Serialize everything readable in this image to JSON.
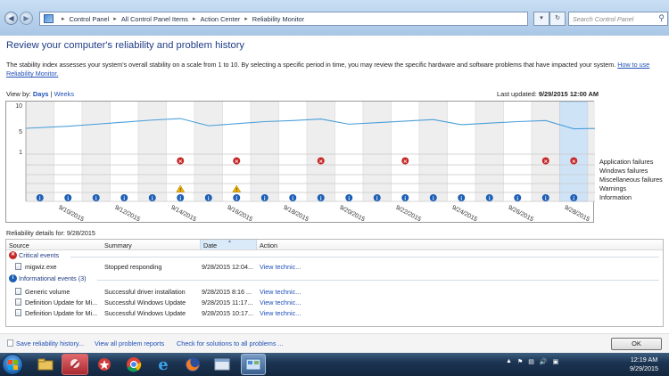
{
  "address_bar": {
    "crumbs": [
      "Control Panel",
      "All Control Panel Items",
      "Action Center",
      "Reliability Monitor"
    ],
    "search_placeholder": "Search Control Panel"
  },
  "page": {
    "title": "Review your computer's reliability and problem history",
    "description": "The stability index assesses your system's overall stability on a scale from 1 to 10. By selecting a specific period in time, you may review the specific hardware and software problems that have impacted your system.",
    "how_to_link": "How to use Reliability Monitor.",
    "view_by_label": "View by:",
    "view_days": "Days",
    "view_sep": "|",
    "view_weeks": "Weeks",
    "last_updated_label": "Last updated:",
    "last_updated_value": "9/29/2015 12:00 AM"
  },
  "chart_data": {
    "type": "line",
    "y_ticks": [
      "10",
      "5",
      "1"
    ],
    "ylim": [
      1,
      10
    ],
    "x_labels": [
      "9/10/2015",
      "9/12/2015",
      "9/14/2015",
      "9/16/2015",
      "9/18/2015",
      "9/20/2015",
      "9/22/2015",
      "9/24/2015",
      "9/26/2015",
      "9/28/2015"
    ],
    "days": [
      "9/9",
      "9/10",
      "9/11",
      "9/12",
      "9/13",
      "9/14",
      "9/15",
      "9/16",
      "9/17",
      "9/18",
      "9/19",
      "9/20",
      "9/21",
      "9/22",
      "9/23",
      "9/24",
      "9/25",
      "9/26",
      "9/27",
      "9/28",
      "9/29"
    ],
    "selected_day_index": 19,
    "stability_index": [
      5.5,
      5.9,
      6.3,
      6.7,
      7.1,
      7.4,
      6.0,
      6.4,
      6.8,
      7.0,
      7.3,
      6.3,
      6.6,
      6.9,
      7.2,
      6.2,
      6.5,
      6.8,
      7.0,
      5.4,
      5.5
    ],
    "rows": [
      "Application failures",
      "Windows failures",
      "Miscellaneous failures",
      "Warnings",
      "Information"
    ],
    "application_failures": [
      5,
      7,
      10,
      13,
      18,
      19
    ],
    "warnings": [
      5,
      7
    ],
    "information": [
      0,
      1,
      2,
      3,
      4,
      5,
      6,
      7,
      8,
      9,
      10,
      11,
      12,
      13,
      14,
      15,
      16,
      17,
      18,
      19
    ],
    "colors": {
      "line": "#4a9fd8",
      "selected": "#cfe3f7",
      "shaded": "#eeeeee",
      "error": "#c62828",
      "warning": "#f2b300",
      "info": "#1c5fb5"
    }
  },
  "details": {
    "label": "Reliability details for: 9/28/2015",
    "columns": {
      "source": "Source",
      "summary": "Summary",
      "date": "Date",
      "action": "Action"
    },
    "critical_header": "Critical events",
    "critical_rows": [
      {
        "source": "migwiz.exe",
        "summary": "Stopped responding",
        "date": "9/28/2015 12:04...",
        "action": "View  technic..."
      }
    ],
    "info_header": "Informational events (3)",
    "info_rows": [
      {
        "source": "Generic volume",
        "summary": "Successful driver installation",
        "date": "9/28/2015 8:16 ...",
        "action": "View  technic..."
      },
      {
        "source": "Definition Update for Mi...",
        "summary": "Successful Windows Update",
        "date": "9/28/2015 11:17...",
        "action": "View  technic..."
      },
      {
        "source": "Definition Update for Mi...",
        "summary": "Successful Windows Update",
        "date": "9/28/2015 10:17...",
        "action": "View  technic..."
      }
    ]
  },
  "footer": {
    "save_link": "Save reliability history...",
    "all_reports_link": "View all problem reports",
    "check_solutions_link": "Check for solutions to all problems ...",
    "ok_label": "OK"
  },
  "taskbar": {
    "time": "12:19 AM",
    "date": "9/29/2015"
  }
}
